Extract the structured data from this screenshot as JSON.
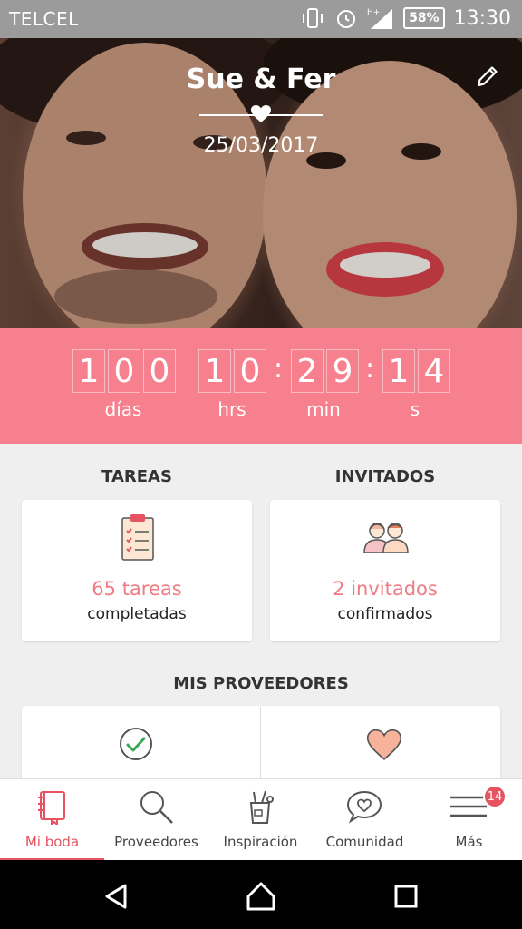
{
  "status": {
    "carrier": "TELCEL",
    "battery": "58%",
    "time": "13:30"
  },
  "header": {
    "couple": "Sue & Fer",
    "date": "25/03/2017"
  },
  "countdown": {
    "days_digits": [
      "1",
      "0",
      "0"
    ],
    "hours_digits": [
      "1",
      "0"
    ],
    "minutes_digits": [
      "2",
      "9"
    ],
    "seconds_digits": [
      "1",
      "4"
    ],
    "labels": {
      "days": "días",
      "hours": "hrs",
      "minutes": "min",
      "seconds": "s"
    }
  },
  "tareas": {
    "title": "TAREAS",
    "count": "65 tareas",
    "sub": "completadas"
  },
  "invitados": {
    "title": "INVITADOS",
    "count": "2 invitados",
    "sub": "confirmados"
  },
  "proveedores": {
    "title": "MIS PROVEEDORES"
  },
  "nav": {
    "items": [
      {
        "label": "Mi boda",
        "icon": "book-icon"
      },
      {
        "label": "Proveedores",
        "icon": "search-icon"
      },
      {
        "label": "Inspiración",
        "icon": "tools-icon"
      },
      {
        "label": "Comunidad",
        "icon": "chat-heart-icon"
      },
      {
        "label": "Más",
        "icon": "menu-icon"
      }
    ],
    "badge": "14"
  },
  "colors": {
    "accent": "#e65361",
    "countdown_bg": "#f7808e",
    "status_bg": "#9b9b9b"
  }
}
